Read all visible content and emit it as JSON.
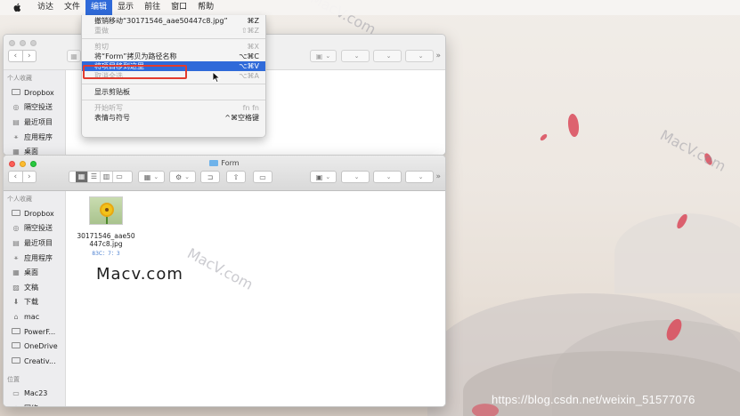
{
  "menubar": {
    "items": [
      "访达",
      "文件",
      "编辑",
      "显示",
      "前往",
      "窗口",
      "帮助"
    ],
    "active": "编辑"
  },
  "edit_menu": {
    "items": [
      {
        "label": "撤销移动“30171546_aae50447c8.jpg”",
        "shortcut": "⌘Z",
        "state": "normal"
      },
      {
        "label": "重做",
        "shortcut": "⇧⌘Z",
        "state": "disabled"
      },
      {
        "label": "剪切",
        "shortcut": "⌘X",
        "state": "disabled"
      },
      {
        "label": "将“Form”拷贝为路径名称",
        "shortcut": "⌥⌘C",
        "state": "normal"
      },
      {
        "label": "将项目移到这里",
        "shortcut": "⌥⌘V",
        "state": "highlighted"
      },
      {
        "label": "取消全选",
        "shortcut": "⌥⌘A",
        "state": "disabled"
      },
      {
        "label": "显示剪贴板",
        "shortcut": "",
        "state": "normal"
      },
      {
        "label": "开始听写",
        "shortcut": "fn fn",
        "state": "disabled"
      },
      {
        "label": "表情与符号",
        "shortcut": "^⌘空格键",
        "state": "normal"
      }
    ]
  },
  "front_window": {
    "title": "Form",
    "sidebar": {
      "favorites_header": "个人收藏",
      "favorites": [
        {
          "label": "Dropbox",
          "icon": "folder-icon"
        },
        {
          "label": "隔空投送",
          "icon": "airdrop-icon"
        },
        {
          "label": "最近项目",
          "icon": "recents-icon"
        },
        {
          "label": "应用程序",
          "icon": "applications-icon"
        },
        {
          "label": "桌面",
          "icon": "desktop-icon"
        },
        {
          "label": "文稿",
          "icon": "documents-icon"
        },
        {
          "label": "下载",
          "icon": "downloads-icon"
        },
        {
          "label": "mac",
          "icon": "home-icon"
        },
        {
          "label": "PowerF...",
          "icon": "folder-icon"
        },
        {
          "label": "OneDrive",
          "icon": "folder-icon"
        },
        {
          "label": "Creativ...",
          "icon": "folder-icon"
        }
      ],
      "locations_header": "位置",
      "locations": [
        {
          "label": "Mac23",
          "icon": "computer-icon"
        },
        {
          "label": "网络",
          "icon": "network-icon"
        }
      ]
    },
    "file": {
      "name_line1": "30171546_aae50",
      "name_line2": "447c8.jpg",
      "meta": "83C：7：3"
    }
  },
  "back_window": {
    "sidebar": {
      "favorites_header": "个人收藏",
      "favorites": [
        {
          "label": "Dropbox",
          "icon": "folder-icon"
        },
        {
          "label": "隔空投送",
          "icon": "airdrop-icon"
        },
        {
          "label": "最近项目",
          "icon": "recents-icon"
        },
        {
          "label": "应用程序",
          "icon": "applications-icon"
        },
        {
          "label": "桌面",
          "icon": "desktop-icon"
        }
      ]
    }
  },
  "logo_text": "Macv.com",
  "watermark_url": "https://blog.csdn.net/weixin_51577076",
  "colors": {
    "accent": "#2f6ad9",
    "highlight_box": "#e23b2e",
    "petal": "#d94a5a"
  }
}
